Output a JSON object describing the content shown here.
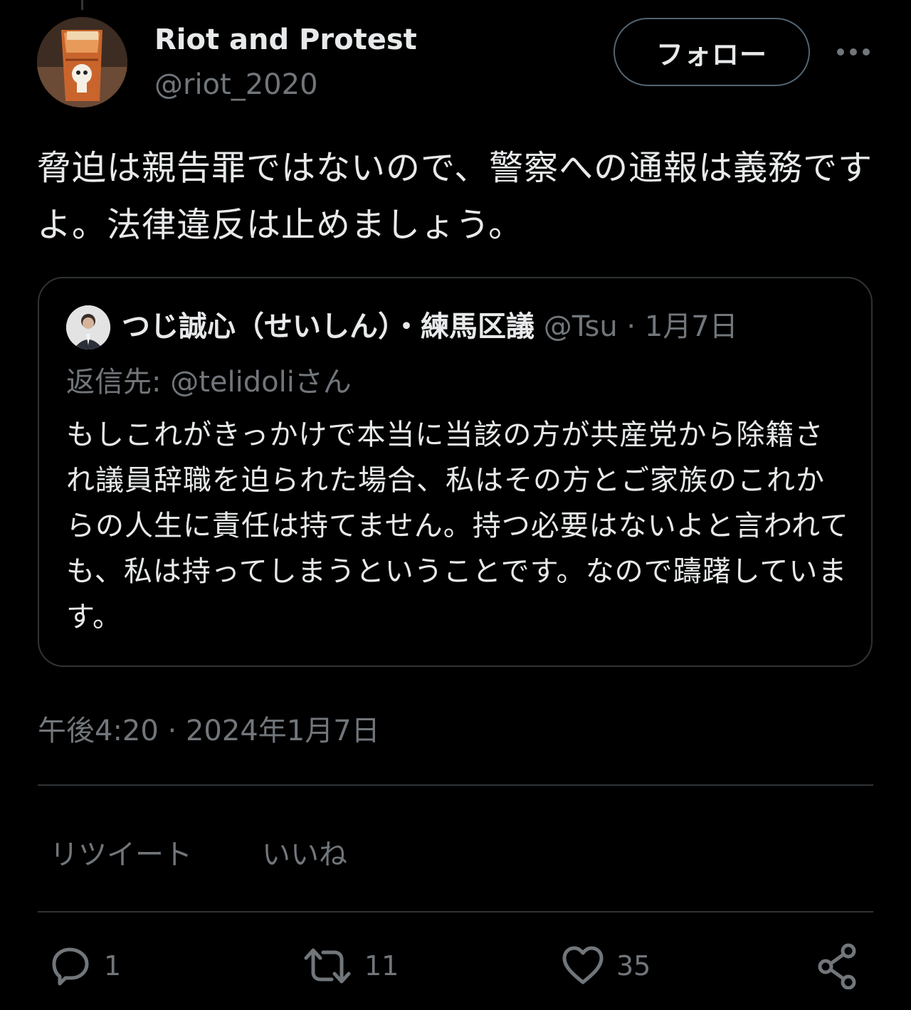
{
  "tweet": {
    "author": {
      "name": "Riot and Protest",
      "handle": "@riot_2020"
    },
    "follow_label": "フォロー",
    "text": "脅迫は親告罪ではないので、警察への通報は義務ですよ。法律違反は止めましょう。",
    "timestamp": "午後4:20 · 2024年1月7日"
  },
  "quote": {
    "author": "つじ誠心（せいしん）・練馬区議",
    "meta": " @Tsu · 1月7日",
    "reply_prefix": "返信先: ",
    "reply_to": "@telidoli",
    "reply_suffix": "さん",
    "text": "もしこれがきっかけで本当に当該の方が共産党から除籍され議員辞職を迫られた場合、私はその方とご家族のこれからの人生に責任は持てません。持つ必要はないよと言われても、私は持ってしまうということです。なので躊躇しています。"
  },
  "stats": {
    "retweets_label": "リツイート",
    "likes_label": "いいね"
  },
  "actions": {
    "reply_count": "1",
    "retweet_count": "11",
    "like_count": "35"
  },
  "colors": {
    "background": "#000000",
    "text": "#e7e9ea",
    "muted": "#71767b",
    "border": "#2f3336"
  },
  "icons": {
    "more": "more-dots-icon",
    "reply": "reply-bubble-icon",
    "retweet": "retweet-icon",
    "like": "heart-icon",
    "share": "share-icon"
  }
}
